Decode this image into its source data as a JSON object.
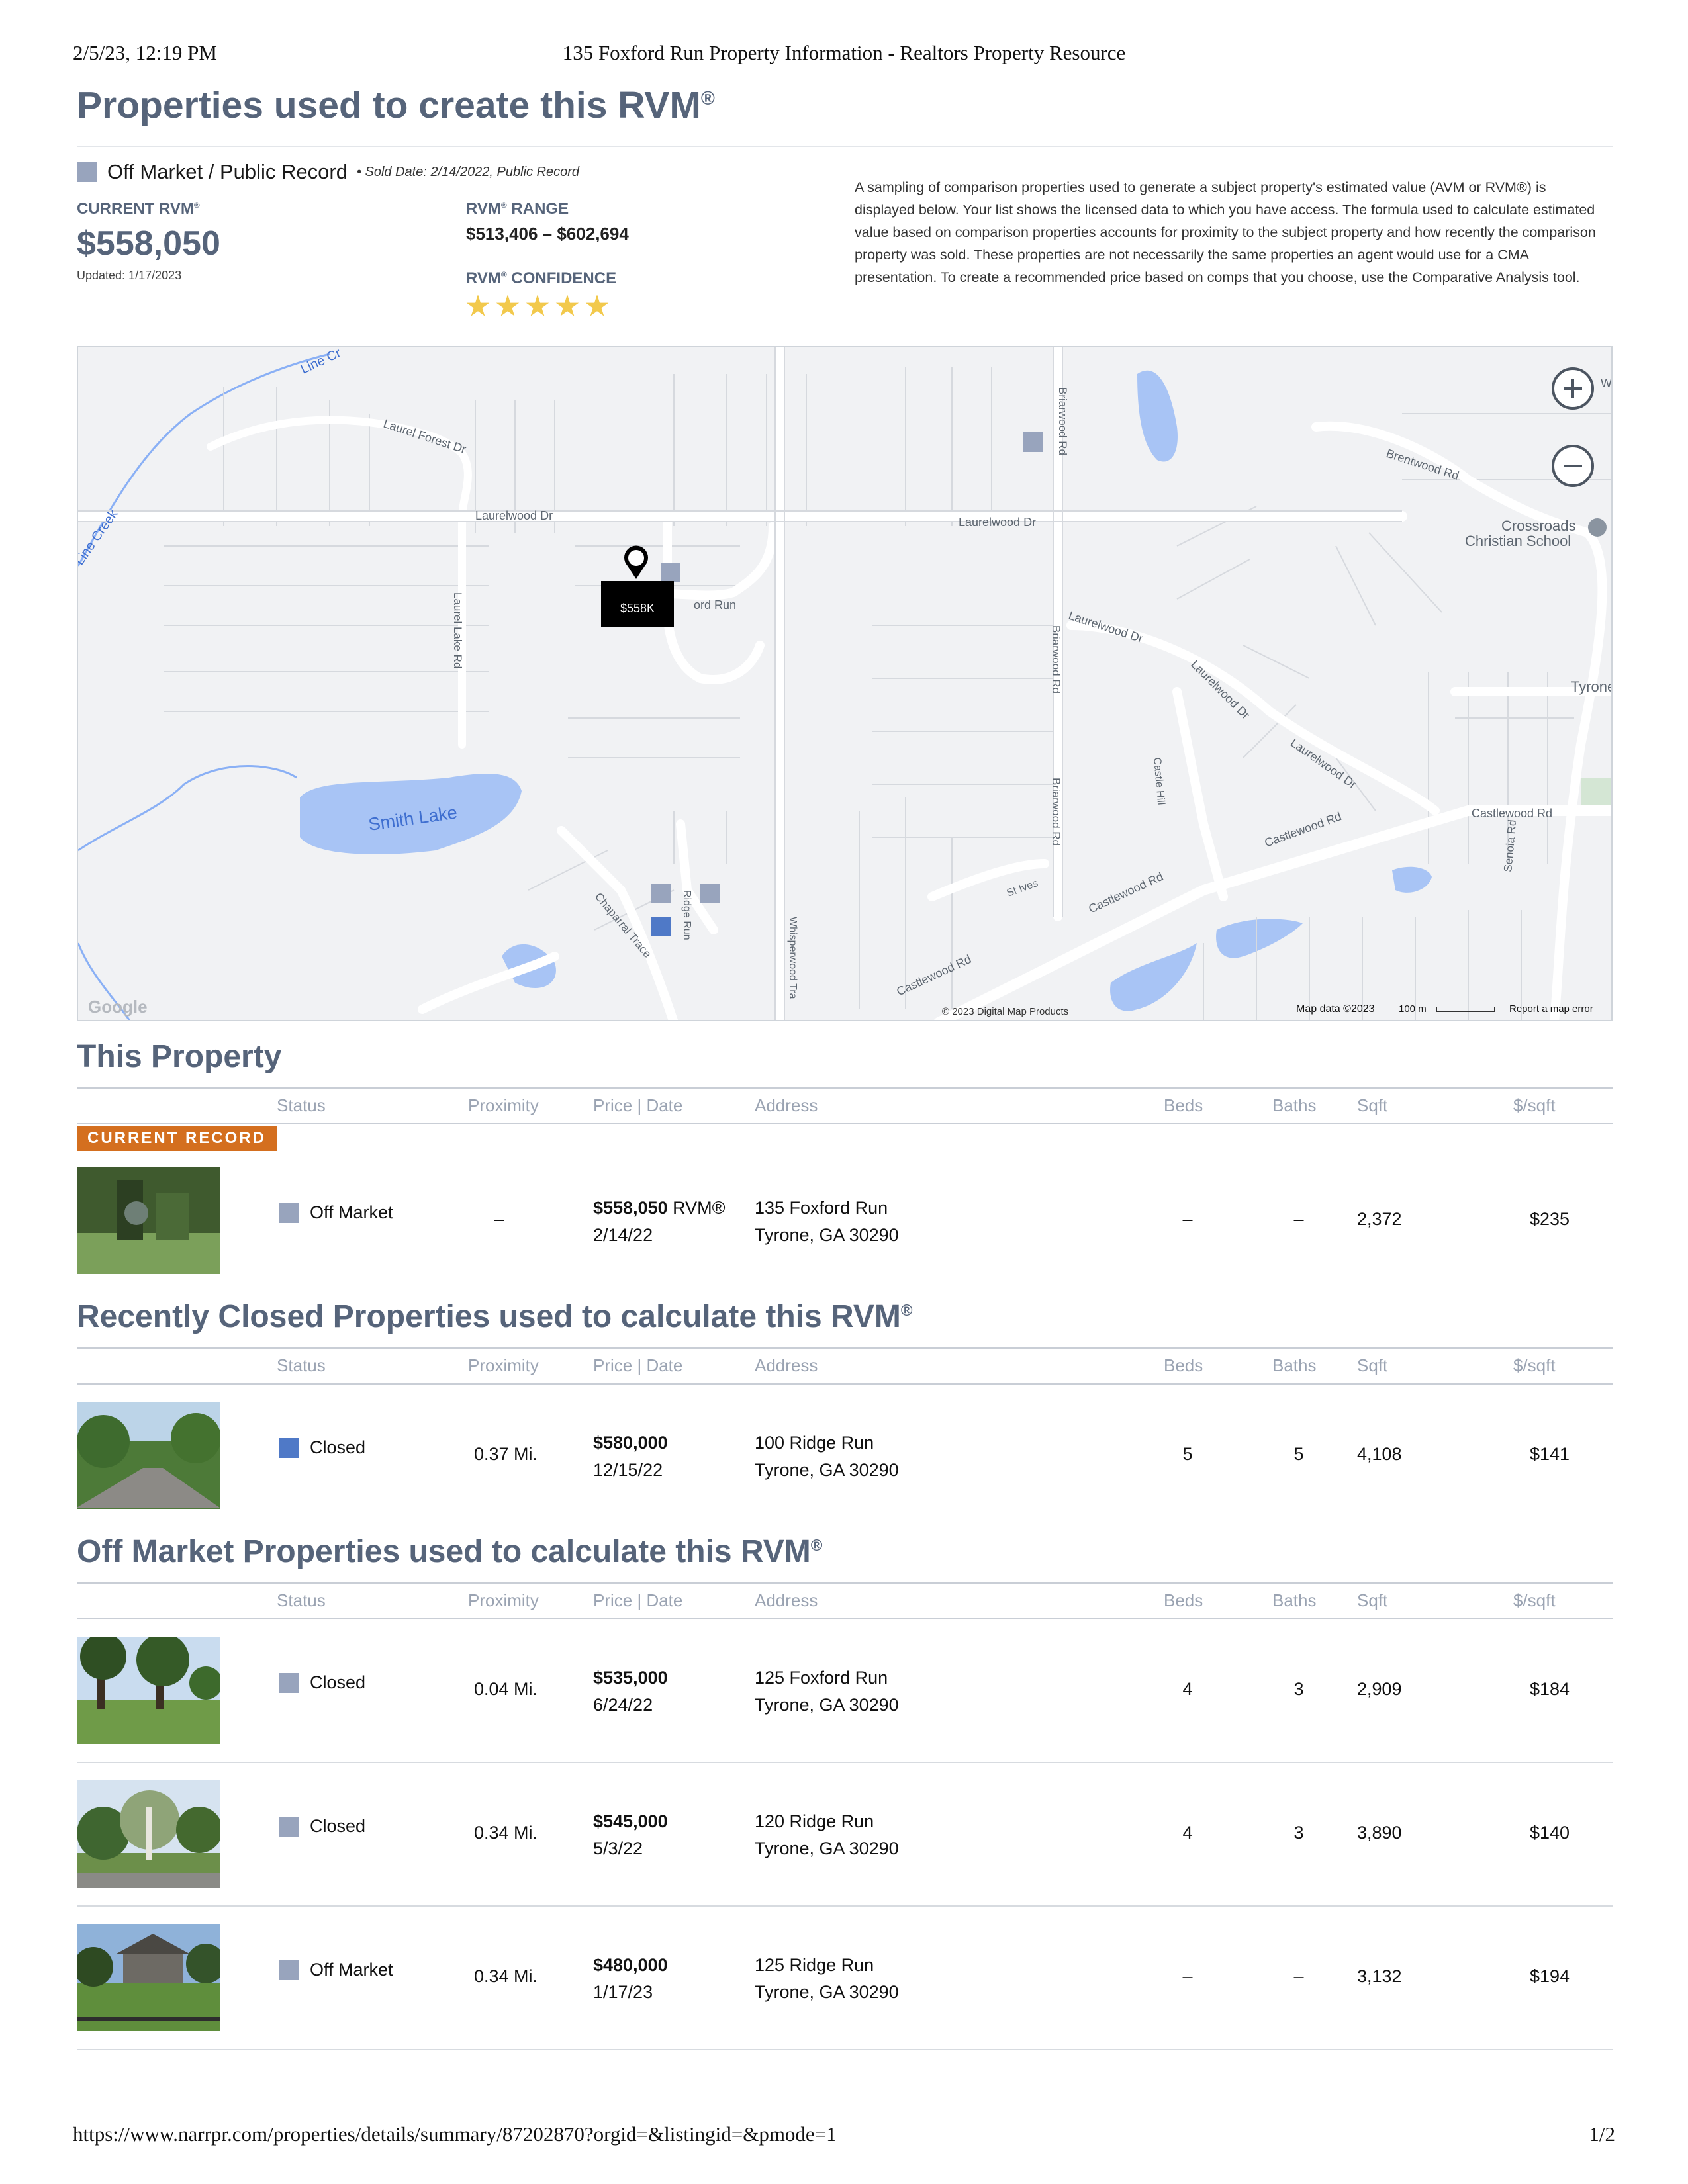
{
  "print_header": {
    "date": "2/5/23, 12:19 PM",
    "title": "135 Foxford Run Property Information - Realtors Property Resource"
  },
  "print_footer": {
    "url": "https://www.narrpr.com/properties/details/summary/87202870?orgid=&listingid=&pmode=1",
    "page": "1/2"
  },
  "page_title": "Properties used to create this RVM",
  "registered_mark": "®",
  "summary": {
    "status": "Off Market / Public Record",
    "sold_note": "• Sold Date: 2/14/2022, Public Record",
    "current_rvm_label": "CURRENT RVM",
    "current_rvm_value": "$558,050",
    "updated": "Updated: 1/17/2023",
    "range_label": "RANGE",
    "range_value": "$513,406 – $602,694",
    "confidence_label": "CONFIDENCE",
    "rvm_prefix": "RVM",
    "confidence_stars": 5,
    "description": "A sampling of comparison properties used to generate a subject property's estimated value (AVM or RVM®) is displayed below. Your list shows the licensed data to which you have access. The formula used to calculate estimated value based on comparison properties accounts for proximity to the subject property and how recently the comparison property was sold. These properties are not necessarily the same properties an agent would use for a CMA presentation. To create a recommended price based on comps that you choose, use the Comparative Analysis tool."
  },
  "map": {
    "marker_label": "$558K",
    "labels": {
      "laurelwood_dr_1": "Laurelwood Dr",
      "laurelwood_dr_2": "Laurelwood Dr",
      "laurelwood_dr_3": "Laurelwood Dr",
      "laurelwood_dr_4": "Laurelwood Dr",
      "laurelwood_dr_5": "Laurelwood Dr",
      "laurel_forest": "Laurel Forest Dr",
      "laurel_lake": "Laurel Lake Rd",
      "foxford": "ord Run",
      "briarwood_1": "Briarwood Rd",
      "briarwood_2": "Briarwood Rd",
      "briarwood_3": "Briarwood Rd",
      "brentwood": "Brentwood Rd",
      "crossroads": "Crossroads",
      "christian_school": "Christian School",
      "tyrone": "Tyrone",
      "castlewood_1": "Castlewood Rd",
      "castlewood_2": "Castlewood Rd",
      "castlewood_3": "Castlewood Rd",
      "castlewood_4": "Castlewood Rd",
      "castle_hill": "Castle Hill",
      "senoia": "Senoia Rd",
      "st_ives": "St Ives",
      "smith_lake": "Smith Lake",
      "ridge_run": "Ridge Run",
      "chaparral": "Chaparral Trace",
      "whisperwood": "Whisperwood Tra",
      "line_creek_1": "Line Cr",
      "line_creek_2": "Line Creek",
      "partial_way": "Way"
    },
    "google_logo": "Google",
    "copyright": "© 2023 Digital Map Products",
    "map_data": "Map data ©2023",
    "scale": "100 m",
    "report_error": "Report a map error"
  },
  "table_headers": {
    "status": "Status",
    "proximity": "Proximity",
    "price_date": "Price | Date",
    "address": "Address",
    "beds": "Beds",
    "baths": "Baths",
    "sqft": "Sqft",
    "ppsf": "$/sqft"
  },
  "this_property": {
    "heading": "This Property",
    "badge": "CURRENT RECORD",
    "row": {
      "status": "Off Market",
      "proximity": "–",
      "price": "$558,050",
      "price_suffix": "RVM®",
      "date": "2/14/22",
      "address1": "135 Foxford Run",
      "address2": "Tyrone, GA 30290",
      "beds": "–",
      "baths": "–",
      "sqft": "2,372",
      "ppsf": "$235"
    }
  },
  "recently_closed": {
    "heading": "Recently Closed Properties used to calculate this RVM",
    "rows": [
      {
        "status": "Closed",
        "proximity": "0.37 Mi.",
        "price": "$580,000",
        "date": "12/15/22",
        "address1": "100 Ridge Run",
        "address2": "Tyrone, GA 30290",
        "beds": "5",
        "baths": "5",
        "sqft": "4,108",
        "ppsf": "$141"
      }
    ]
  },
  "off_market": {
    "heading": "Off Market Properties used to calculate this RVM",
    "rows": [
      {
        "status": "Closed",
        "proximity": "0.04 Mi.",
        "price": "$535,000",
        "date": "6/24/22",
        "address1": "125 Foxford Run",
        "address2": "Tyrone, GA 30290",
        "beds": "4",
        "baths": "3",
        "sqft": "2,909",
        "ppsf": "$184"
      },
      {
        "status": "Closed",
        "proximity": "0.34 Mi.",
        "price": "$545,000",
        "date": "5/3/22",
        "address1": "120 Ridge Run",
        "address2": "Tyrone, GA 30290",
        "beds": "4",
        "baths": "3",
        "sqft": "3,890",
        "ppsf": "$140"
      },
      {
        "status": "Off Market",
        "proximity": "0.34 Mi.",
        "price": "$480,000",
        "date": "1/17/23",
        "address1": "125 Ridge Run",
        "address2": "Tyrone, GA 30290",
        "beds": "–",
        "baths": "–",
        "sqft": "3,132",
        "ppsf": "$194"
      }
    ]
  },
  "colors": {
    "heading": "#56647a",
    "off_market_marker": "#98a4bd",
    "closed_marker": "#4f79c7",
    "badge": "#d46f1f",
    "water": "#a8c4f5",
    "star": "#f2c94c"
  }
}
